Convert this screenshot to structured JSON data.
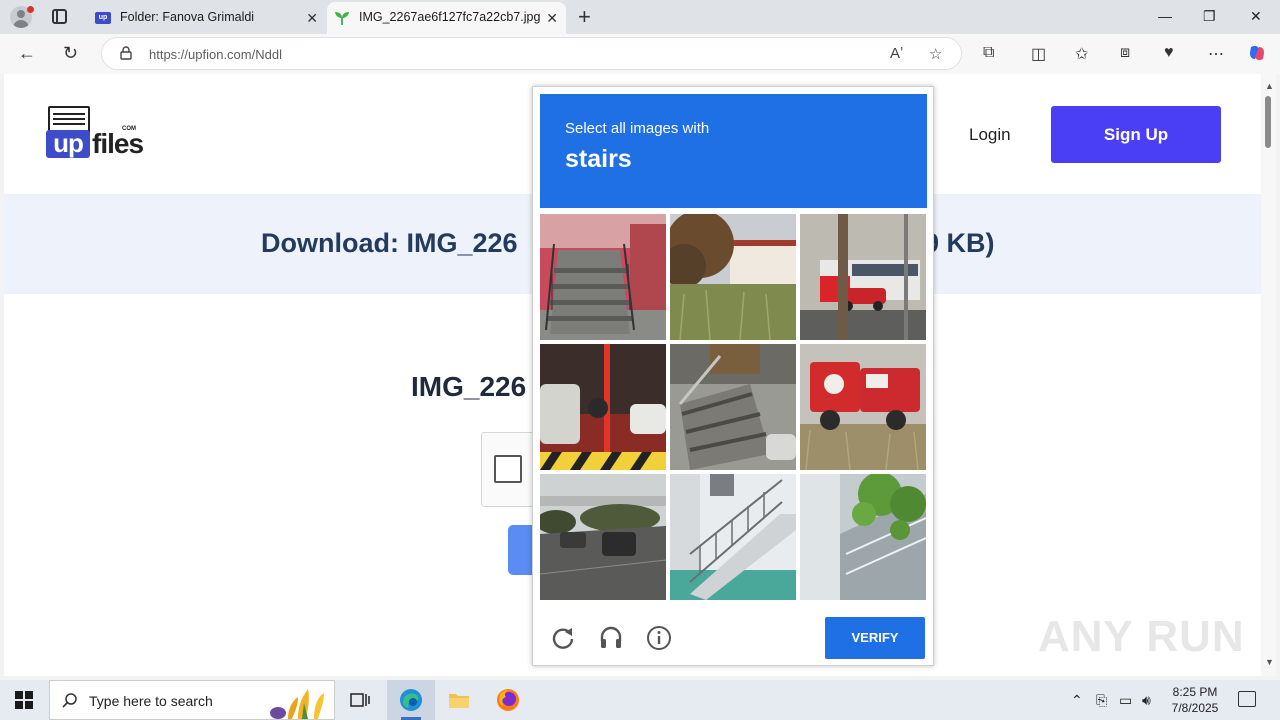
{
  "browser": {
    "tabs": [
      {
        "title": "Folder: Fanova Grimaldi",
        "favicon": "upfiles-icon"
      },
      {
        "title": "IMG_2267ae6f127fc7a22cb7.jpg",
        "favicon": "leaf-icon",
        "active": true
      }
    ],
    "url": "https://upfion.com/Nddl"
  },
  "site": {
    "logo_main": "files",
    "logo_prefix": "up",
    "logo_suffix": "COM",
    "login_label": "Login",
    "signup_label": "Sign Up",
    "download_title": "Download: IMG_226",
    "download_size_tail": "9 KB)",
    "file_name": "IMG_226"
  },
  "captcha": {
    "prompt": "Select all images with",
    "target": "stairs",
    "verify_label": "VERIFY",
    "tiles": [
      "stairs-red-wall",
      "tree-houses",
      "red-bus-street",
      "parked-motorbikes",
      "stone-steps",
      "red-truck-field",
      "road-cars-bridge",
      "white-railing-stairs",
      "green-plant-building"
    ],
    "footer_icons": [
      "refresh-icon",
      "audio-icon",
      "info-icon"
    ],
    "accent_color": "#1f6fe5"
  },
  "watermark": "ANY RUN",
  "taskbar": {
    "search_placeholder": "Type here to search",
    "time": "8:25 PM",
    "date": "7/8/2025"
  }
}
